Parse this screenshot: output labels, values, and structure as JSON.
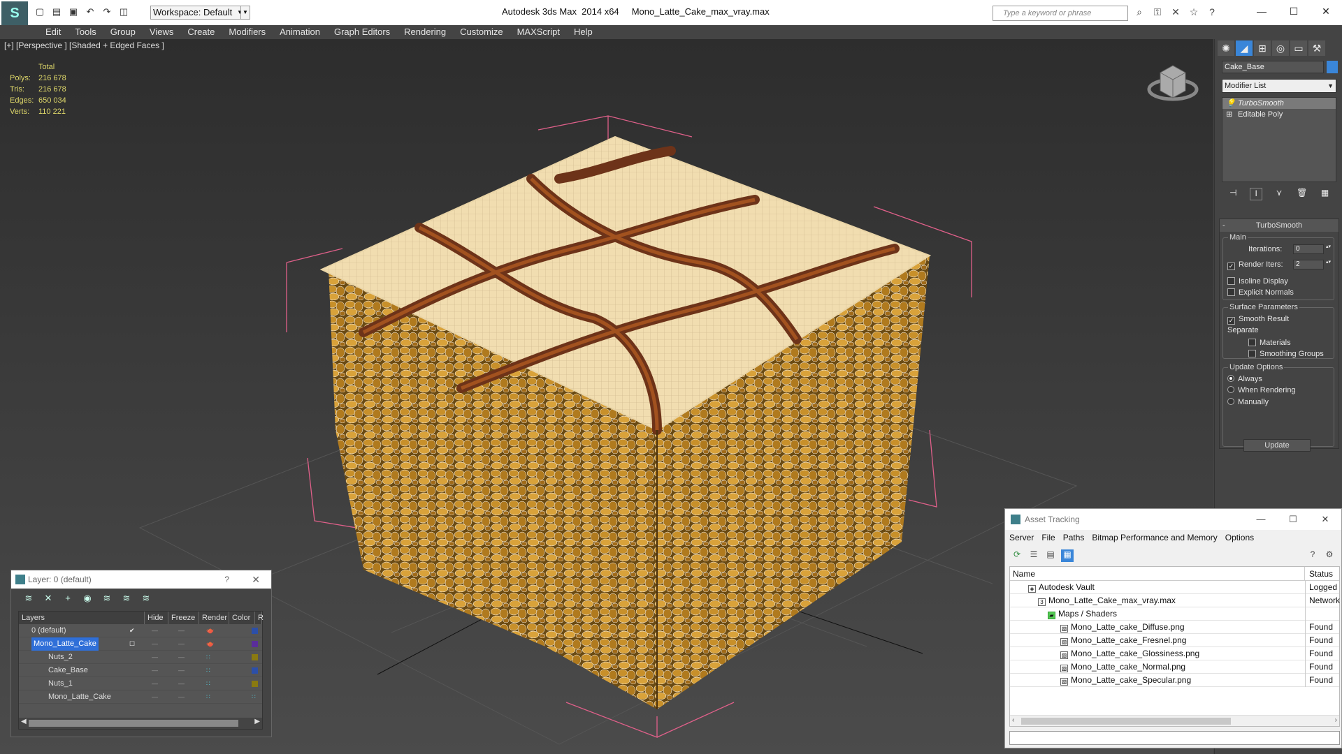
{
  "titlebar": {
    "workspace": "Workspace: Default",
    "app_title": "Autodesk 3ds Max  2014 x64     Mono_Latte_Cake_max_vray.max",
    "search_placeholder": "Type a keyword or phrase"
  },
  "menu": [
    "Edit",
    "Tools",
    "Group",
    "Views",
    "Create",
    "Modifiers",
    "Animation",
    "Graph Editors",
    "Rendering",
    "Customize",
    "MAXScript",
    "Help"
  ],
  "viewport": {
    "label": "[+] [Perspective ] [Shaded + Edged Faces ]",
    "stats_header": "Total",
    "stats": [
      {
        "k": "Polys:",
        "v": "216 678"
      },
      {
        "k": "Tris:",
        "v": "216 678"
      },
      {
        "k": "Edges:",
        "v": "650 034"
      },
      {
        "k": "Verts:",
        "v": "110 221"
      }
    ]
  },
  "command_panel": {
    "object_name": "Cake_Base",
    "modifier_list": "Modifier List",
    "stack": [
      "TurboSmooth",
      "Editable Poly"
    ],
    "rollout_title": "TurboSmooth",
    "main_label": "Main",
    "iterations_label": "Iterations:",
    "iterations_value": "0",
    "render_iters_label": "Render Iters:",
    "render_iters_value": "2",
    "isoline": "Isoline Display",
    "explicit_normals": "Explicit Normals",
    "surface_params": "Surface Parameters",
    "smooth_result": "Smooth Result",
    "separate": "Separate",
    "materials": "Materials",
    "smoothing_groups": "Smoothing Groups",
    "update_options": "Update Options",
    "always": "Always",
    "when_rendering": "When Rendering",
    "manually": "Manually",
    "update_button": "Update"
  },
  "layer_window": {
    "title": "Layer: 0 (default)",
    "help": "?",
    "columns": [
      "Layers",
      "Hide",
      "Freeze",
      "Render",
      "Color",
      "R"
    ],
    "rows": [
      {
        "name": "0 (default)",
        "color": "#2c4fa8"
      },
      {
        "name": "Mono_Latte_Cake",
        "color": "#5a2d9a"
      },
      {
        "name": "Nuts_2",
        "color": "#8a7a10"
      },
      {
        "name": "Cake_Base",
        "color": "#2c4fa8"
      },
      {
        "name": "Nuts_1",
        "color": "#8a7a10"
      },
      {
        "name": "Mono_Latte_Cake",
        "color": "#1d9ab5"
      }
    ]
  },
  "asset_window": {
    "title": "Asset Tracking",
    "menu": [
      "Server",
      "File",
      "Paths",
      "Bitmap Performance and Memory",
      "Options"
    ],
    "col_name": "Name",
    "col_status": "Status",
    "rows": [
      {
        "name": "Autodesk Vault",
        "status": "Logged Out"
      },
      {
        "name": "Mono_Latte_Cake_max_vray.max",
        "status": "Network"
      },
      {
        "name": "Maps / Shaders",
        "status": ""
      },
      {
        "name": "Mono_Latte_cake_Diffuse.png",
        "status": "Found"
      },
      {
        "name": "Mono_Latte_cake_Fresnel.png",
        "status": "Found"
      },
      {
        "name": "Mono_Latte_cake_Glossiness.png",
        "status": "Found"
      },
      {
        "name": "Mono_Latte_cake_Normal.png",
        "status": "Found"
      },
      {
        "name": "Mono_Latte_cake_Specular.png",
        "status": "Found"
      }
    ]
  }
}
